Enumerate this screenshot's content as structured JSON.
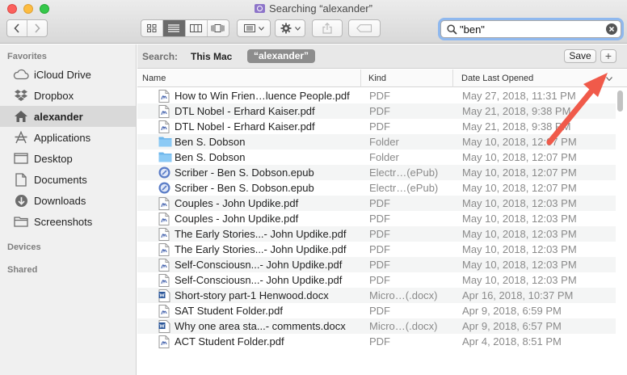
{
  "window": {
    "title": "Searching “alexander”"
  },
  "toolbar": {
    "icons": [
      "back-chevron-icon",
      "forward-chevron-icon",
      "icon-view-icon",
      "list-view-icon",
      "column-view-icon",
      "cover-flow-icon",
      "arrange-icon",
      "gear-icon",
      "share-icon",
      "tag-icon"
    ]
  },
  "search": {
    "value": "\"ben\""
  },
  "sidebar": {
    "favorites_header": "Favorites",
    "items": [
      {
        "label": "iCloud Drive",
        "icon": "cloud-icon"
      },
      {
        "label": "Dropbox",
        "icon": "dropbox-icon"
      },
      {
        "label": "alexander",
        "icon": "home-icon"
      },
      {
        "label": "Applications",
        "icon": "applications-icon"
      },
      {
        "label": "Desktop",
        "icon": "desktop-icon"
      },
      {
        "label": "Documents",
        "icon": "documents-icon"
      },
      {
        "label": "Downloads",
        "icon": "downloads-icon"
      },
      {
        "label": "Screenshots",
        "icon": "folder-icon"
      }
    ],
    "devices_header": "Devices",
    "shared_header": "Shared"
  },
  "scope": {
    "label": "Search:",
    "this_mac": "This Mac",
    "folder": "“alexander”",
    "save": "Save",
    "plus": "+"
  },
  "columns": {
    "name": "Name",
    "kind": "Kind",
    "date": "Date Last Opened"
  },
  "files": [
    {
      "name": "How to Win Frien…luence People.pdf",
      "kind": "PDF",
      "date": "May 27, 2018, 11:31 PM",
      "icon": "pdf"
    },
    {
      "name": "DTL Nobel - Erhard Kaiser.pdf",
      "kind": "PDF",
      "date": "May 21, 2018, 9:38 PM",
      "icon": "pdf"
    },
    {
      "name": "DTL Nobel - Erhard Kaiser.pdf",
      "kind": "PDF",
      "date": "May 21, 2018, 9:38 PM",
      "icon": "pdf"
    },
    {
      "name": "Ben S. Dobson",
      "kind": "Folder",
      "date": "May 10, 2018, 12:07 PM",
      "icon": "folder"
    },
    {
      "name": "Ben S. Dobson",
      "kind": "Folder",
      "date": "May 10, 2018, 12:07 PM",
      "icon": "folder"
    },
    {
      "name": "Scriber - Ben S. Dobson.epub",
      "kind": "Electr…(ePub)",
      "date": "May 10, 2018, 12:07 PM",
      "icon": "epub"
    },
    {
      "name": "Scriber - Ben S. Dobson.epub",
      "kind": "Electr…(ePub)",
      "date": "May 10, 2018, 12:07 PM",
      "icon": "epub"
    },
    {
      "name": "Couples - John Updike.pdf",
      "kind": "PDF",
      "date": "May 10, 2018, 12:03 PM",
      "icon": "pdf"
    },
    {
      "name": "Couples - John Updike.pdf",
      "kind": "PDF",
      "date": "May 10, 2018, 12:03 PM",
      "icon": "pdf"
    },
    {
      "name": "The Early Stories...- John Updike.pdf",
      "kind": "PDF",
      "date": "May 10, 2018, 12:03 PM",
      "icon": "pdf"
    },
    {
      "name": "The Early Stories...- John Updike.pdf",
      "kind": "PDF",
      "date": "May 10, 2018, 12:03 PM",
      "icon": "pdf"
    },
    {
      "name": "Self-Consciousn...- John Updike.pdf",
      "kind": "PDF",
      "date": "May 10, 2018, 12:03 PM",
      "icon": "pdf"
    },
    {
      "name": "Self-Consciousn...- John Updike.pdf",
      "kind": "PDF",
      "date": "May 10, 2018, 12:03 PM",
      "icon": "pdf"
    },
    {
      "name": "Short-story part-1 Henwood.docx",
      "kind": "Micro…(.docx)",
      "date": "Apr 16, 2018, 10:37 PM",
      "icon": "docx"
    },
    {
      "name": "SAT Student Folder.pdf",
      "kind": "PDF",
      "date": "Apr 9, 2018, 6:59 PM",
      "icon": "pdf"
    },
    {
      "name": "Why one area sta...- comments.docx",
      "kind": "Micro…(.docx)",
      "date": "Apr 9, 2018, 6:57 PM",
      "icon": "docx"
    },
    {
      "name": "ACT Student Folder.pdf",
      "kind": "PDF",
      "date": "Apr 4, 2018, 8:51 PM",
      "icon": "pdf"
    }
  ],
  "colors": {
    "accent_arrow": "#f05a4a",
    "folder_blue": "#6fb7ec",
    "search_focus": "#8fb8ee"
  }
}
